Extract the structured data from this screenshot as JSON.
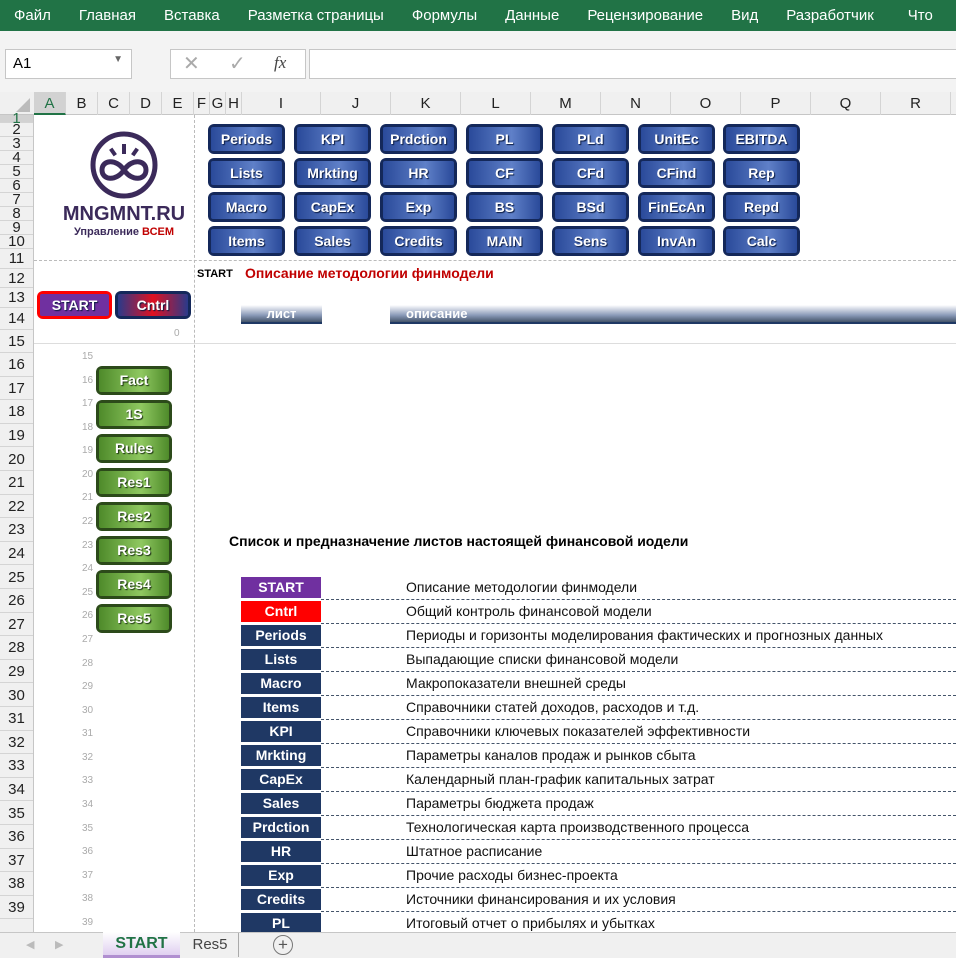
{
  "ribbon": {
    "tabs": [
      "Файл",
      "Главная",
      "Вставка",
      "Разметка страницы",
      "Формулы",
      "Данные",
      "Рецензирование",
      "Вид",
      "Разработчик",
      "Что"
    ]
  },
  "formula_bar": {
    "name_box": "A1",
    "cancel_icon": "x-icon",
    "enter_icon": "check-icon",
    "fx": "fx",
    "value": ""
  },
  "columns": [
    "A",
    "B",
    "C",
    "D",
    "E",
    "F",
    "G",
    "H",
    "I",
    "J",
    "K",
    "L",
    "M",
    "N",
    "O",
    "P",
    "Q",
    "R"
  ],
  "logo": {
    "text": "MNGMNT.RU",
    "tagline_1": "Управление ",
    "tagline_2": "ВСЕМ",
    "color": "#3b2a5a"
  },
  "nav_buttons": [
    [
      "Periods",
      "KPI",
      "Prdction",
      "PL",
      "PLd",
      "UnitEc",
      "EBITDA"
    ],
    [
      "Lists",
      "Mrkting",
      "HR",
      "CF",
      "CFd",
      "CFind",
      "Rep"
    ],
    [
      "Macro",
      "CapEx",
      "Exp",
      "BS",
      "BSd",
      "FinEcAn",
      "Repd"
    ],
    [
      "Items",
      "Sales",
      "Credits",
      "MAIN",
      "Sens",
      "InvAn",
      "Calc"
    ]
  ],
  "start_button": "START",
  "cntrl_button": "Cntrl",
  "zero_value": "0",
  "sheet_label": "START",
  "sheet_title": "Описание методологии финмодели",
  "header_list": "лист",
  "header_desc": "описание",
  "green_buttons": [
    "Fact",
    "1S",
    "Rules",
    "Res1",
    "Res2",
    "Res3",
    "Res4",
    "Res5"
  ],
  "list_title": "Список и предназначение листов настоящей финансовой иодели",
  "sheets": [
    {
      "name": "START",
      "desc": "Описание методологии финмодели",
      "color": "#7030a0"
    },
    {
      "name": "Cntrl",
      "desc": "Общий контроль финансовой модели",
      "color": "#ff0000"
    },
    {
      "name": "Periods",
      "desc": "Периоды и горизонты моделирования фактических и прогнозных данных"
    },
    {
      "name": "Lists",
      "desc": "Выпадающие списки финансовой модели"
    },
    {
      "name": "Macro",
      "desc": "Макропоказатели внешней среды"
    },
    {
      "name": "Items",
      "desc": "Справочники статей доходов, расходов и т.д."
    },
    {
      "name": "KPI",
      "desc": "Справочники ключевых показателей эффективности"
    },
    {
      "name": "Mrkting",
      "desc": "Параметры каналов продаж и рынков сбыта"
    },
    {
      "name": "CapEx",
      "desc": "Календарный план-график капитальных затрат"
    },
    {
      "name": "Sales",
      "desc": "Параметры бюджета продаж"
    },
    {
      "name": "Prdction",
      "desc": "Технологическая карта производственного процесса"
    },
    {
      "name": "HR",
      "desc": "Штатное расписание"
    },
    {
      "name": "Exp",
      "desc": "Прочие расходы бизнес-проекта"
    },
    {
      "name": "Credits",
      "desc": "Источники финансирования и их условия"
    },
    {
      "name": "PL",
      "desc": "Итоговый отчет о прибылях и убытках"
    }
  ],
  "sheet_tabs": [
    "START",
    "Res5"
  ],
  "colors": {
    "ribbon": "#217346",
    "nav_button": "#14285a",
    "sheet_label_bg": "#1f3864",
    "title_red": "#c00000"
  }
}
